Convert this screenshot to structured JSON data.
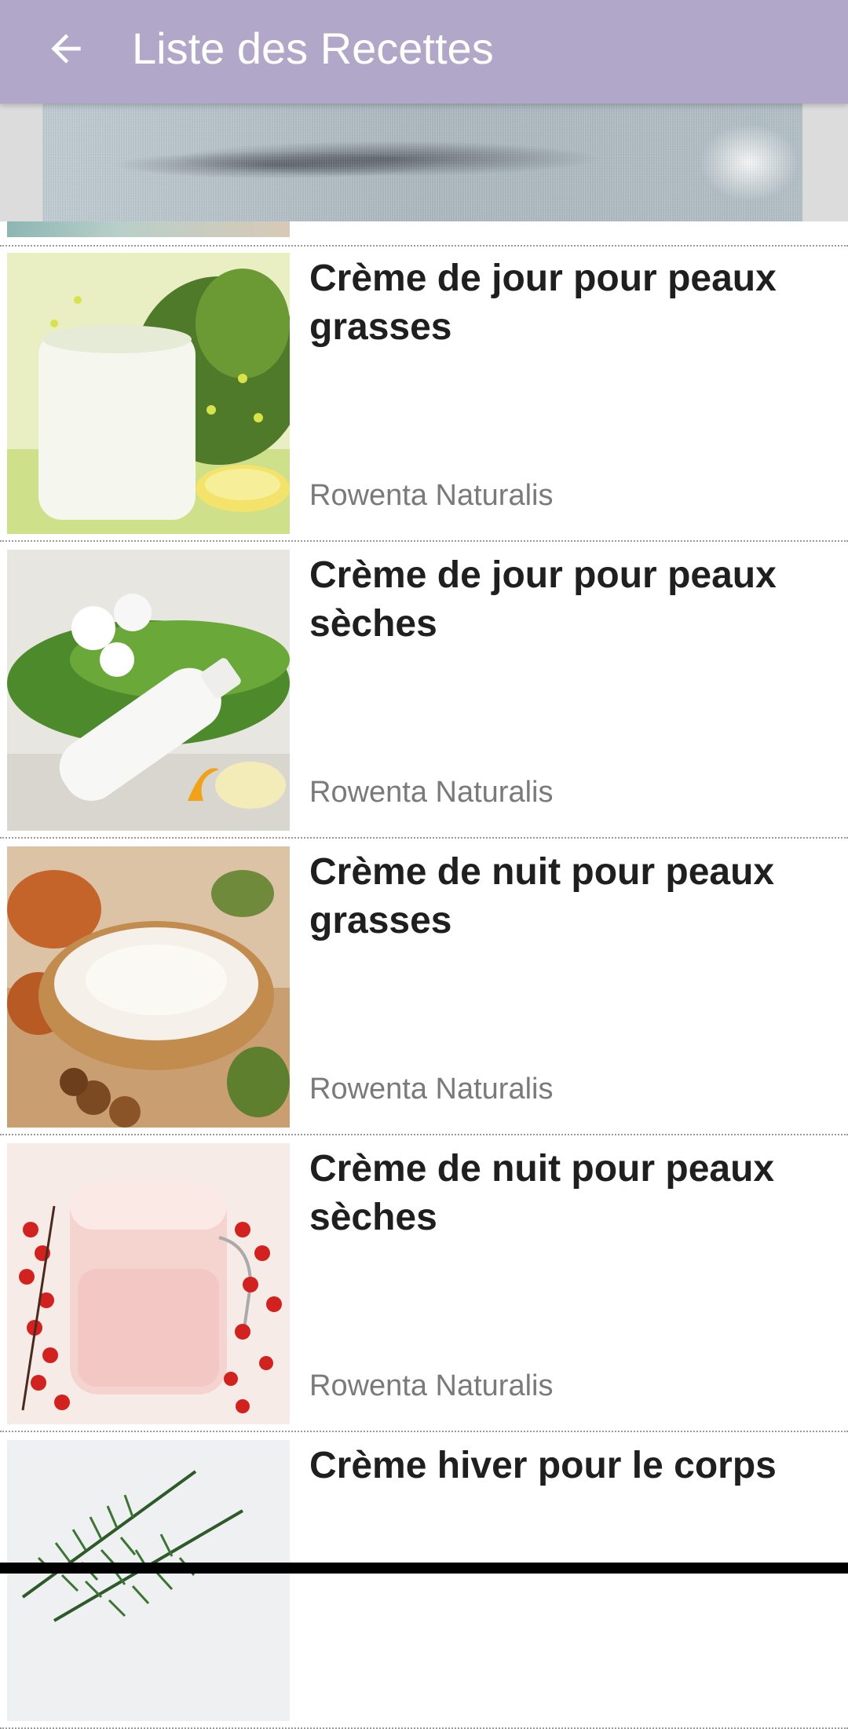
{
  "app_bar": {
    "title": "Liste des Recettes",
    "background_color": "#b1a8c9",
    "back_icon": "arrow-left-icon"
  },
  "ad_banner": {
    "type": "advertisement-banner"
  },
  "recipes": [
    {
      "title": "Crème de jour pour peaux grasses",
      "author": "Rowenta Naturalis",
      "image": "cream-jar-with-herbs"
    },
    {
      "title": "Crème de jour pour peaux sèches",
      "author": "Rowenta Naturalis",
      "image": "lotion-bottle-with-moss-and-orchid"
    },
    {
      "title": "Crème de nuit pour peaux grasses",
      "author": "Rowenta Naturalis",
      "image": "cream-in-wooden-bowl-with-hazelnuts"
    },
    {
      "title": "Crème de nuit pour peaux sèches",
      "author": "Rowenta Naturalis",
      "image": "pink-cream-jar-with-red-berries"
    },
    {
      "title": "Crème hiver pour le corps",
      "author": "",
      "image": "rosemary-sprigs"
    }
  ],
  "colors": {
    "title_text": "#1f1f1f",
    "author_text": "#7a7a7a",
    "divider": "#9a9a9a"
  }
}
